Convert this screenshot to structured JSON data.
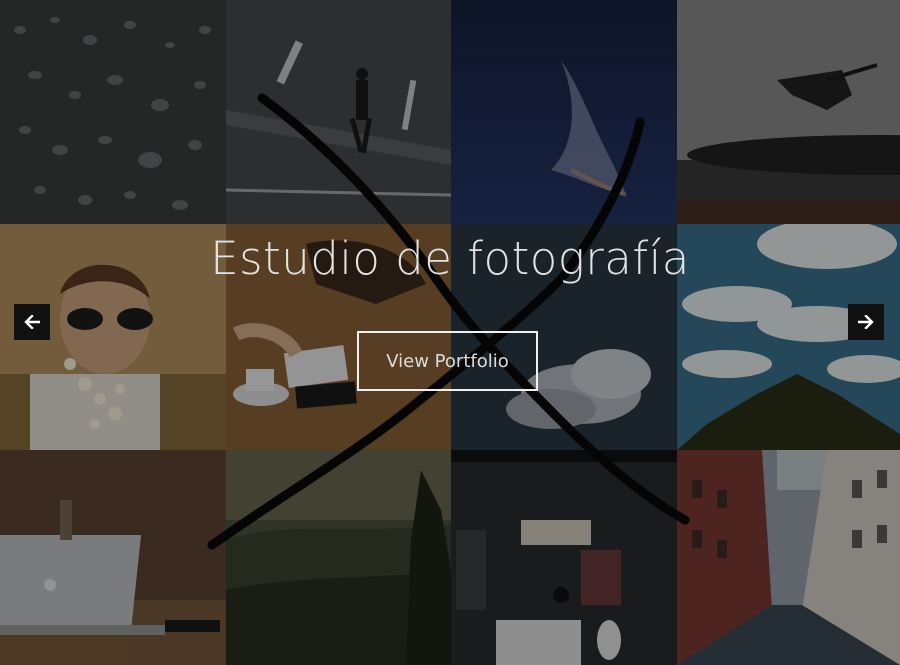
{
  "hero": {
    "title": "Estudio de fotografía",
    "cta_label": "View Portfolio"
  },
  "navigation": {
    "prev_icon": "arrow-left-icon",
    "next_icon": "arrow-right-icon"
  },
  "tiles": [
    {
      "subject": "water-droplets"
    },
    {
      "subject": "man-walking-on-road"
    },
    {
      "subject": "night-sky-cloud"
    },
    {
      "subject": "record-player"
    },
    {
      "subject": "woman-with-sunglasses-and-flowers"
    },
    {
      "subject": "desk-with-notebook-and-coffee"
    },
    {
      "subject": "dark-sky-cloud"
    },
    {
      "subject": "clouds-over-hill"
    },
    {
      "subject": "laptop-on-table"
    },
    {
      "subject": "forest-landscape"
    },
    {
      "subject": "workspace-top-view"
    },
    {
      "subject": "city-street"
    }
  ],
  "colors": {
    "overlay": "#000000",
    "text": "#e3e3e3",
    "button_border": "#f0f0f0",
    "arrow_bg": "#111111"
  }
}
